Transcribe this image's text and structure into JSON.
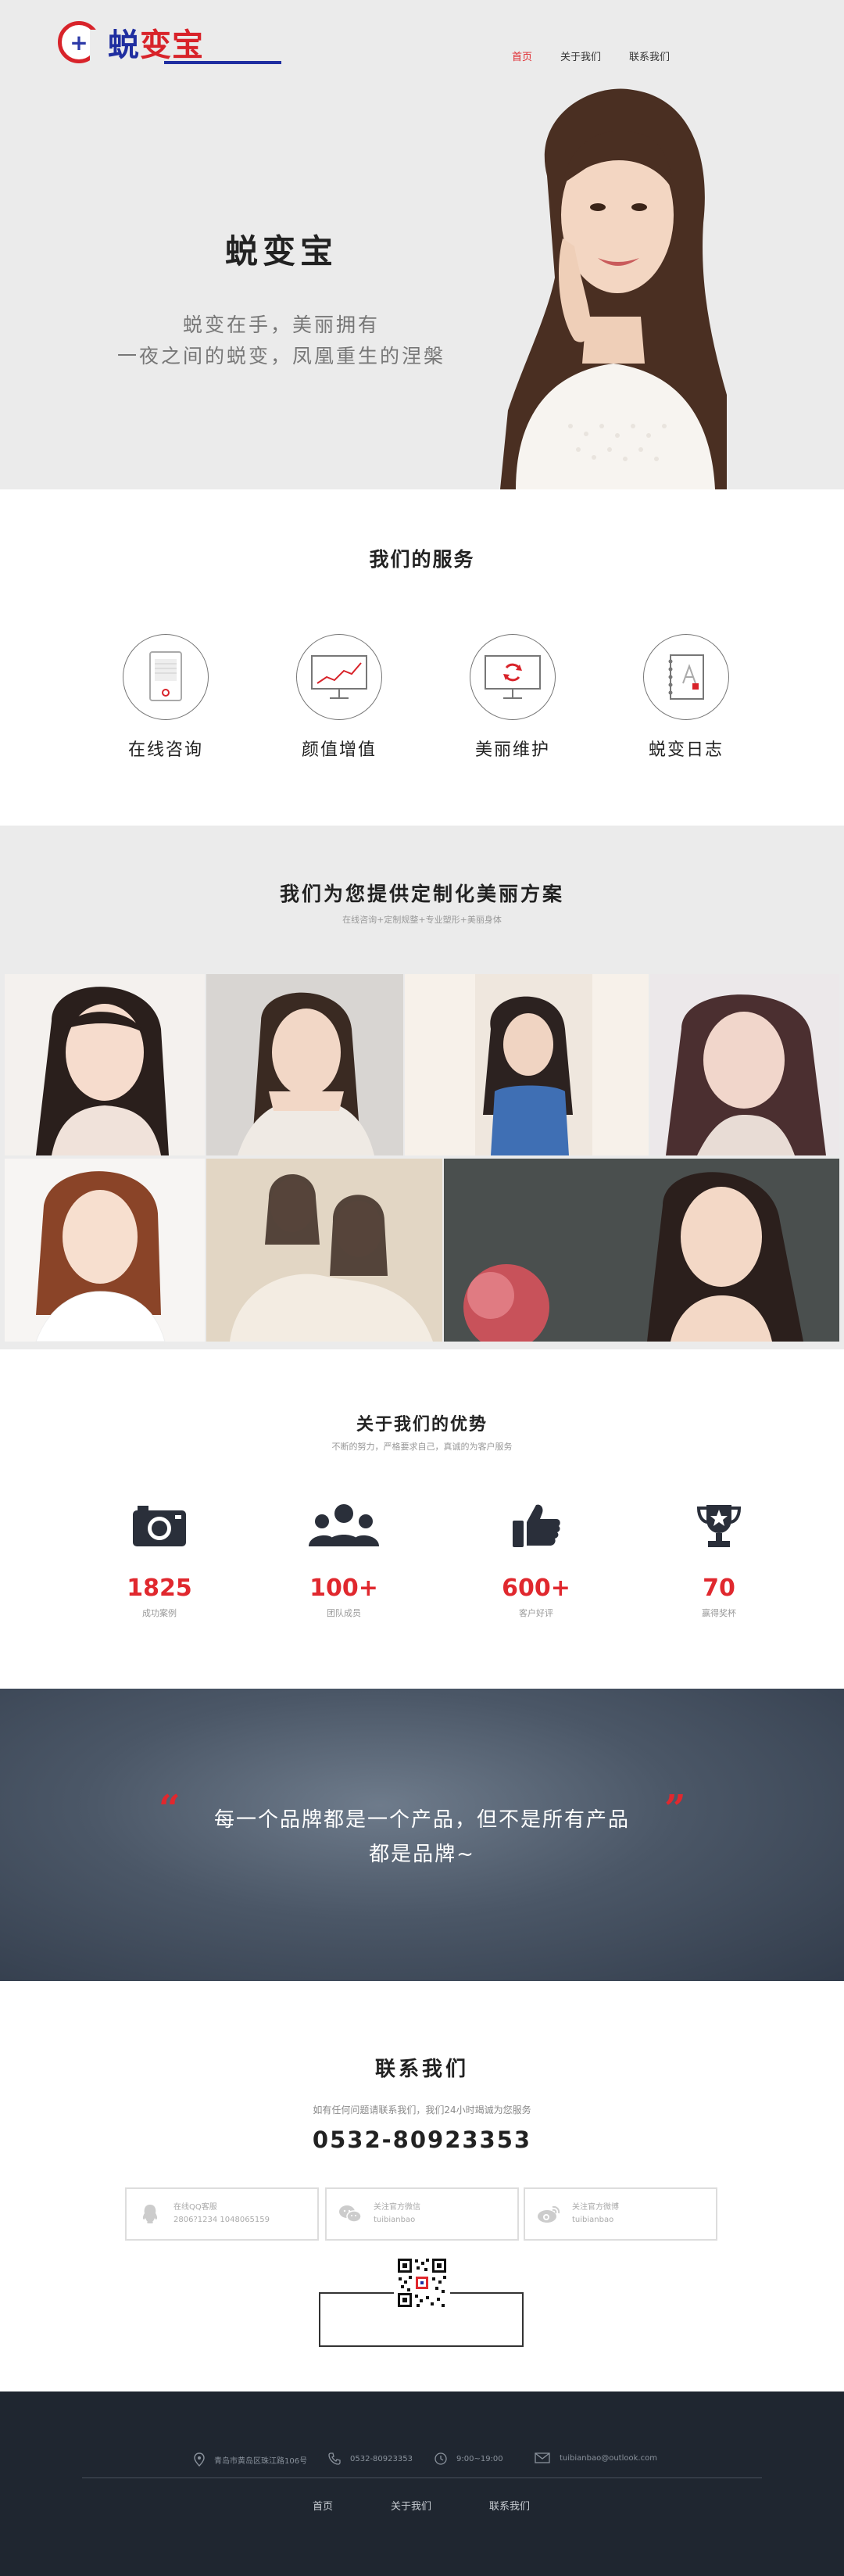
{
  "brand": {
    "badge": "+",
    "name_part1": "蜕",
    "name_part2": "变宝"
  },
  "nav": [
    {
      "label": "首页",
      "active": true
    },
    {
      "label": "关于我们",
      "active": false
    },
    {
      "label": "联系我们",
      "active": false
    }
  ],
  "hero": {
    "title": "蜕变宝",
    "line1": "蜕变在手，美丽拥有",
    "line2": "一夜之间的蜕变，凤凰重生的涅槃"
  },
  "services": {
    "title": "我们的服务",
    "items": [
      {
        "label": "在线咨询",
        "icon": "consult-icon"
      },
      {
        "label": "颜值增值",
        "icon": "chart-icon"
      },
      {
        "label": "美丽维护",
        "icon": "refresh-monitor-icon"
      },
      {
        "label": "蜕变日志",
        "icon": "notebook-icon"
      }
    ]
  },
  "plan": {
    "title": "我们为您提供定制化美丽方案",
    "subtitle": "在线咨询+定制规整+专业塑形+美丽身体"
  },
  "advantages": {
    "title": "关于我们的优势",
    "subtitle": "不断的努力，严格要求自己，真诚的为客户服务",
    "stats": [
      {
        "number": "1825",
        "label": "成功案例",
        "icon": "camera-icon"
      },
      {
        "number": "100+",
        "label": "团队成员",
        "icon": "team-icon"
      },
      {
        "number": "600+",
        "label": "客户好评",
        "icon": "thumbs-up-icon"
      },
      {
        "number": "70",
        "label": "赢得奖杯",
        "icon": "trophy-icon"
      }
    ]
  },
  "quote": {
    "open": "“",
    "close": "”",
    "line1": "每一个品牌都是一个产品，但不是所有产品",
    "line2": "都是品牌~"
  },
  "contact": {
    "title": "联系我们",
    "desc": "如有任何问题请联系我们，我们24小时竭诚为您服务",
    "phone": "0532-80923353",
    "boxes": [
      {
        "title": "在线QQ客服",
        "detail": "2806?1234 1048065159",
        "icon": "qq-icon"
      },
      {
        "title": "关注官方微信",
        "detail": "tuibianbao",
        "icon": "wechat-icon"
      },
      {
        "title": "关注官方微博",
        "detail": "tuibianbao",
        "icon": "weibo-icon"
      }
    ]
  },
  "footer": {
    "address": "青岛市黄岛区珠江路106号",
    "phone": "0532-80923353",
    "hours": "9:00~19:00",
    "email": "tuibianbao@outlook.com",
    "nav": [
      "首页",
      "关于我们",
      "联系我们"
    ]
  }
}
